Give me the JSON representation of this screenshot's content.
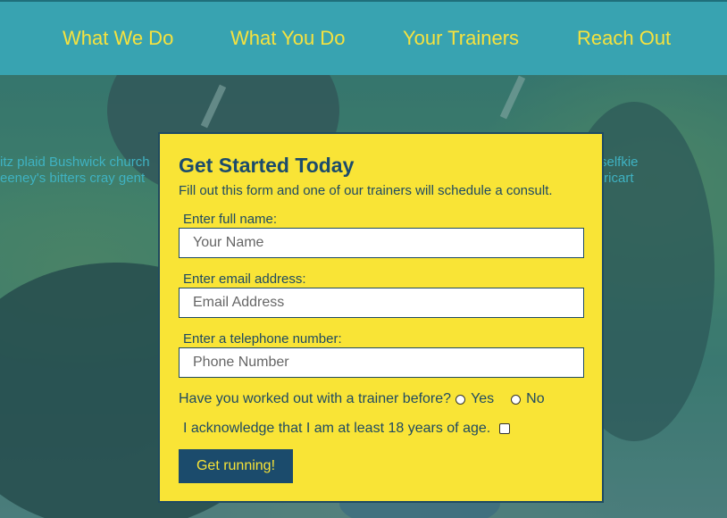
{
  "nav": {
    "items": [
      {
        "label": "What We Do"
      },
      {
        "label": "What You Do"
      },
      {
        "label": "Your Trainers"
      },
      {
        "label": "Reach Out"
      }
    ]
  },
  "background_text": {
    "left_line1": "itz plaid Bushwick church",
    "left_line2": "eeney's bitters cray gent",
    "right_line1": "selfkie",
    "right_line2": "tricart"
  },
  "form": {
    "title": "Get Started Today",
    "subtitle": "Fill out this form and one of our trainers will schedule a consult.",
    "name_label": "Enter full name:",
    "name_placeholder": "Your Name",
    "email_label": "Enter email address:",
    "email_placeholder": "Email Address",
    "phone_label": "Enter a telephone number:",
    "phone_placeholder": "Phone Number",
    "trainer_question": "Have you worked out with a trainer before?",
    "option_yes": "Yes",
    "option_no": "No",
    "acknowledge_text": "I acknowledge that I am at least 18 years of age.",
    "submit_label": "Get running!"
  },
  "colors": {
    "nav_background": "#38a3b1",
    "nav_text": "#f6e23e",
    "panel_background": "#f9e436",
    "panel_text": "#1b4b6c",
    "button_background": "#1b4b6c"
  }
}
